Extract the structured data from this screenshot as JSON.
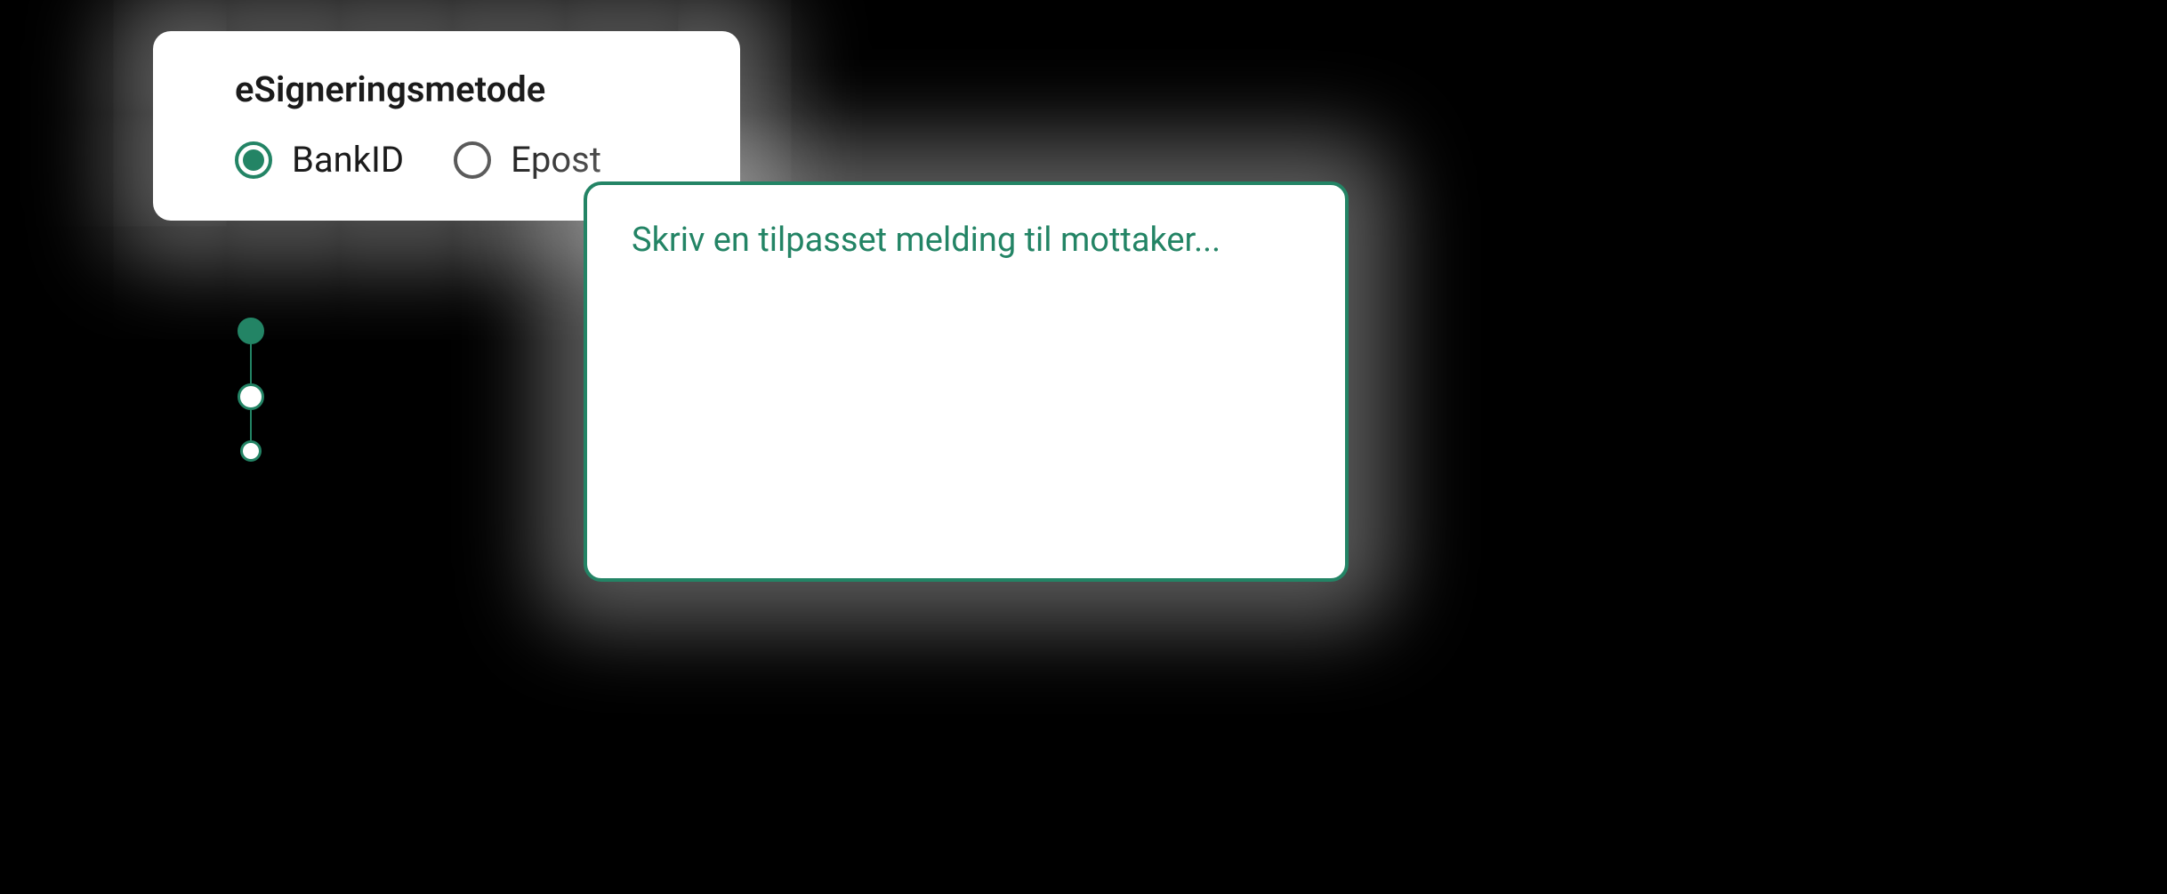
{
  "signingMethod": {
    "title": "eSigneringsmetode",
    "options": {
      "bankid": {
        "label": "BankID",
        "selected": true
      },
      "epost": {
        "label": "Epost",
        "selected": false
      }
    }
  },
  "messageBox": {
    "placeholder": "Skriv en tilpasset melding til mottaker..."
  },
  "stepper": {
    "steps": [
      {
        "filled": true
      },
      {
        "filled": false
      },
      {
        "filled": false
      }
    ]
  },
  "colors": {
    "accent": "#238465",
    "background": "#000000",
    "cardBg": "#ffffff"
  }
}
